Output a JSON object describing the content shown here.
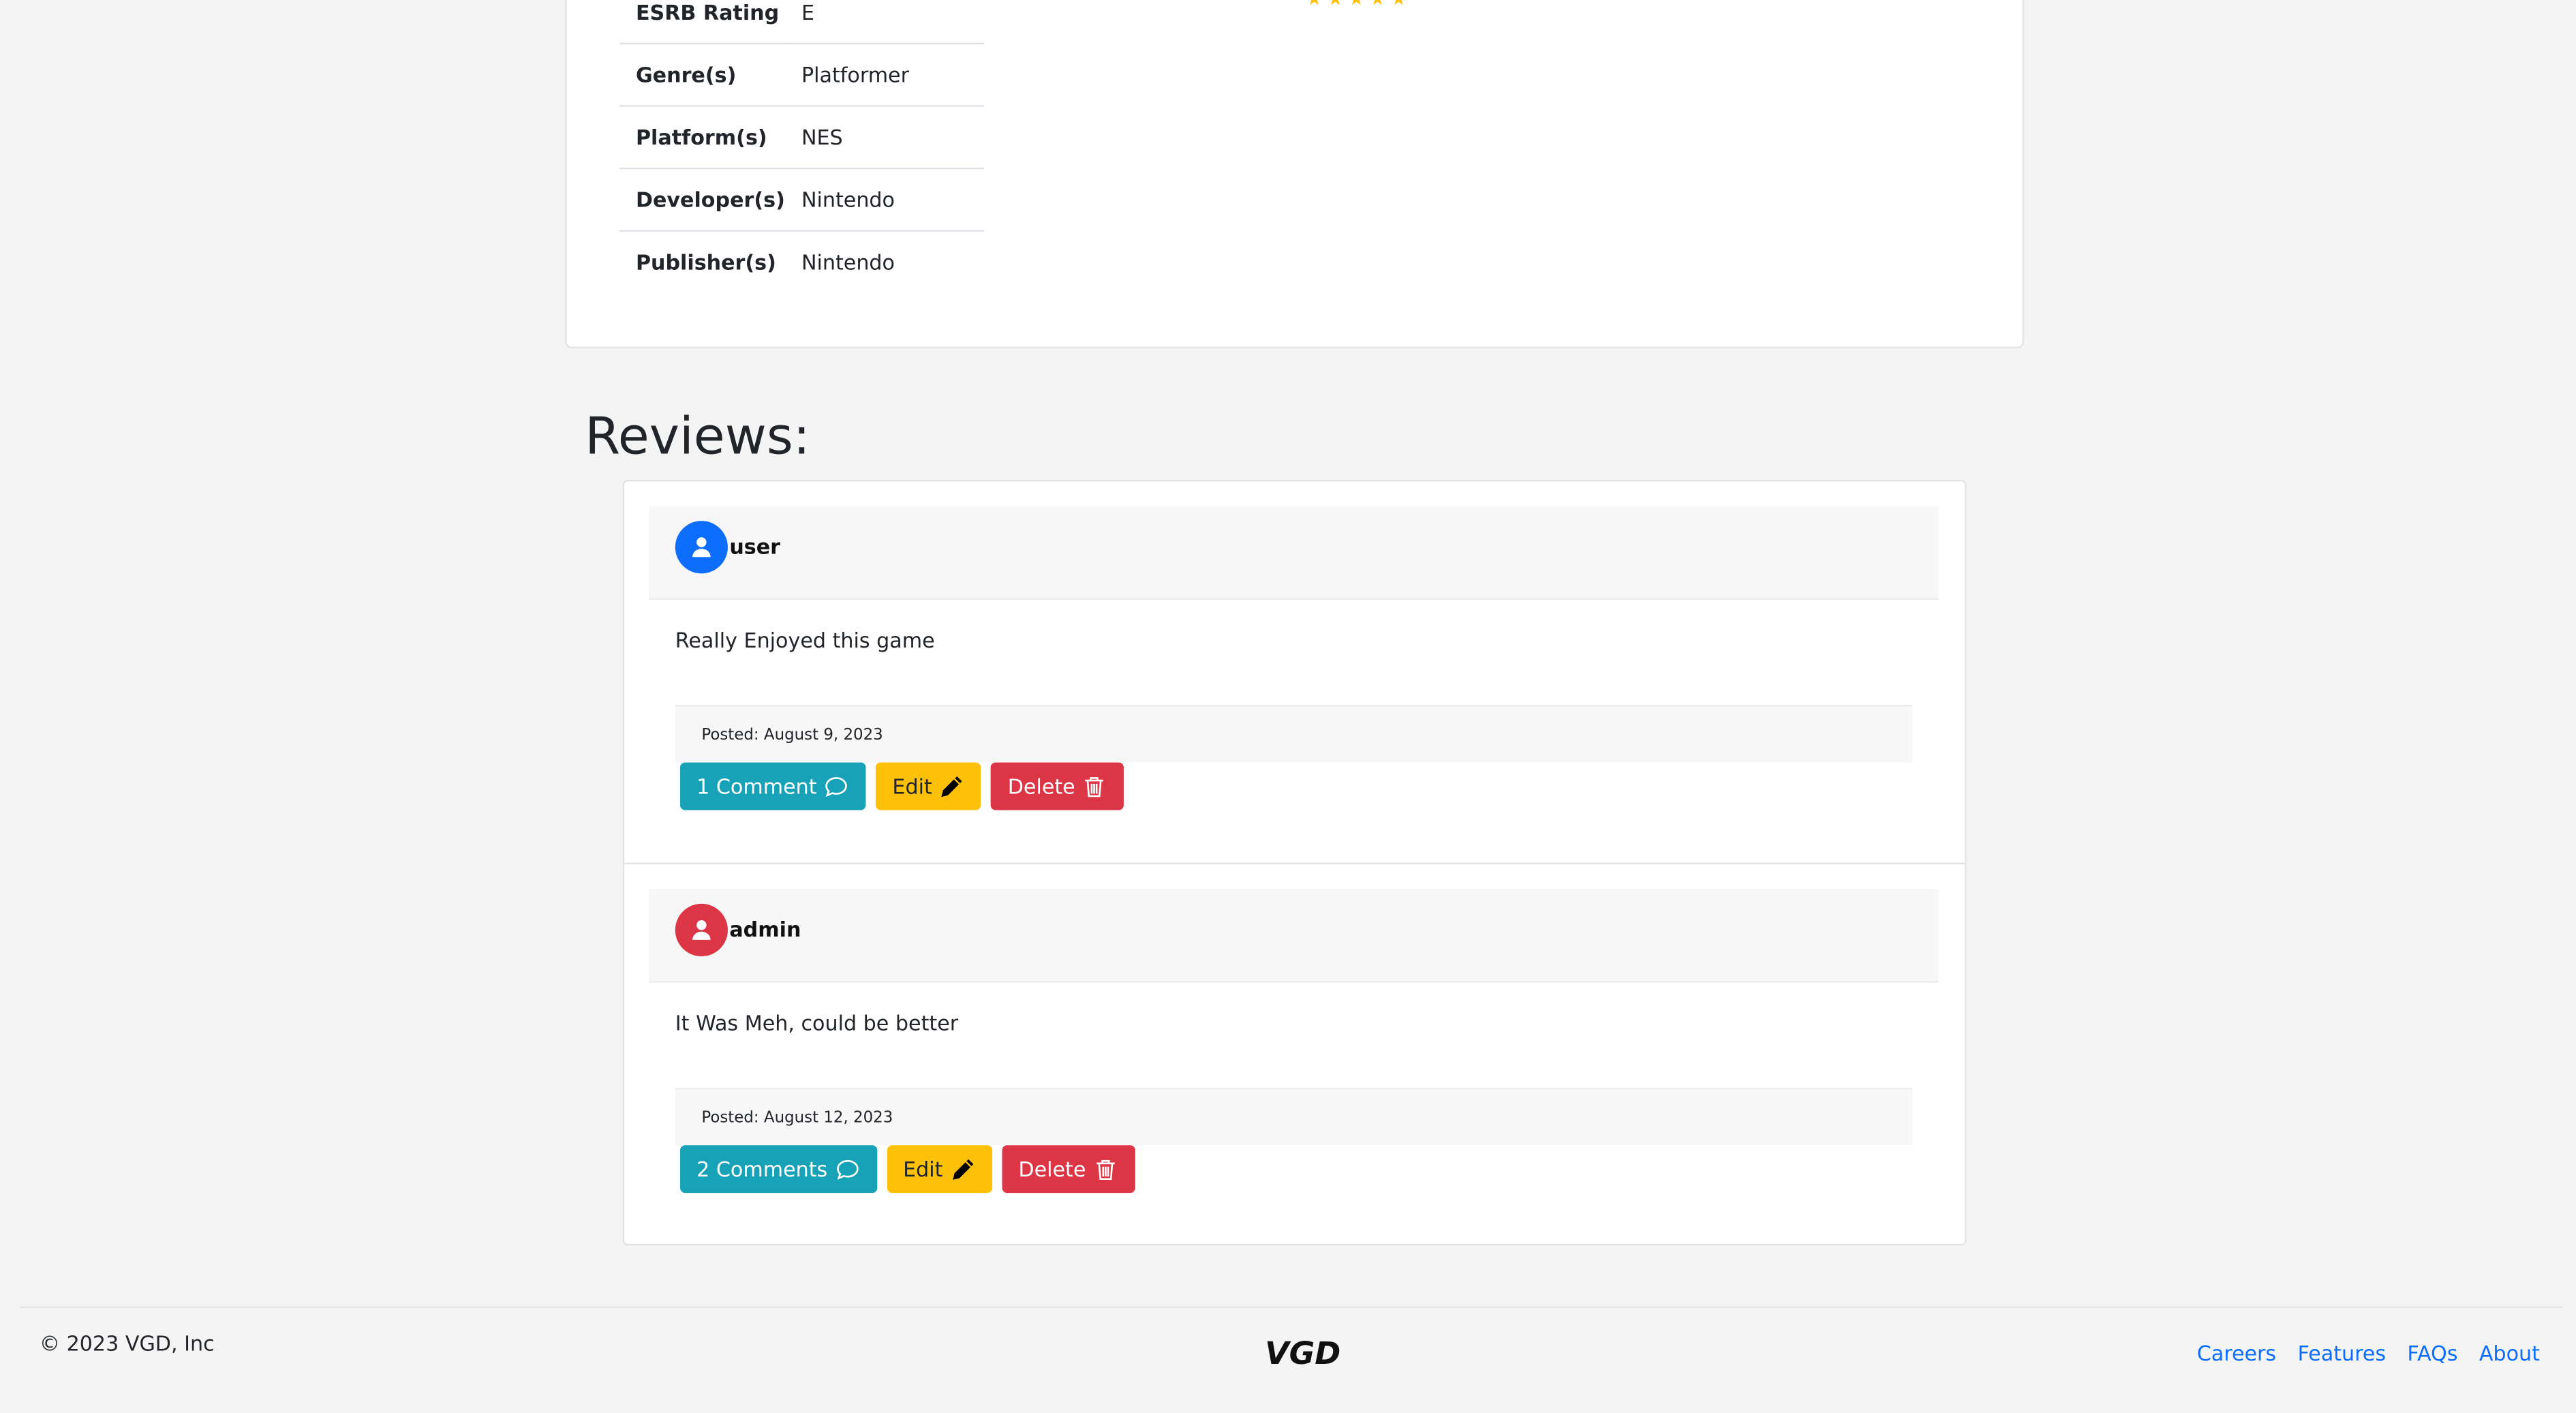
{
  "details": {
    "rows": [
      {
        "label": "ESRB Rating",
        "value": "E"
      },
      {
        "label": "Genre(s)",
        "value": "Platformer"
      },
      {
        "label": "Platform(s)",
        "value": "NES"
      },
      {
        "label": "Developer(s)",
        "value": "Nintendo"
      },
      {
        "label": "Publisher(s)",
        "value": "Nintendo"
      }
    ],
    "rating_stars": "★★★★★",
    "star_color": "#ffc107"
  },
  "reviews": {
    "title": "Reviews:",
    "items": [
      {
        "username": "user",
        "avatar_color": "#0d6efd",
        "text": "Really Enjoyed this game",
        "posted": "Posted: August 9, 2023",
        "comments_label": "1 Comment",
        "edit_label": "Edit",
        "delete_label": "Delete"
      },
      {
        "username": "admin",
        "avatar_color": "#dc3545",
        "text": "It Was Meh, could be better",
        "posted": "Posted: August 12, 2023",
        "comments_label": "2 Comments",
        "edit_label": "Edit",
        "delete_label": "Delete"
      }
    ]
  },
  "footer": {
    "copyright": "© 2023 VGD, Inc",
    "logo_text": "VGD",
    "links": [
      "Careers",
      "Features",
      "FAQs",
      "About"
    ]
  },
  "colors": {
    "comment_button": "#17a2b8",
    "edit_button": "#ffc107",
    "delete_button": "#dc3545",
    "link": "#0d6efd"
  }
}
